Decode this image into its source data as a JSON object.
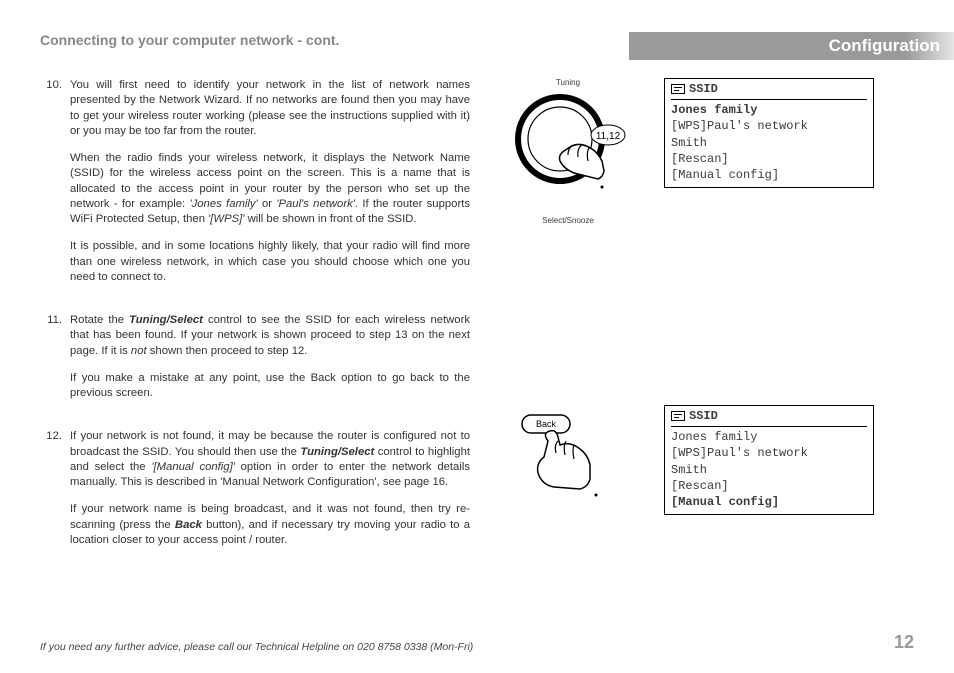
{
  "header": {
    "left": "Connecting to your computer network - cont.",
    "right": "Configuration"
  },
  "steps": {
    "s10": {
      "num": "10.",
      "p1a": "You will first need to identify your network in the list of network names presented by the Network Wizard. If no networks are found then you may have to get your wireless router working (please see the instructions supplied with it) or you may be too far from the router.",
      "p2a": "When the radio finds your wireless network, it displays the Network Name (SSID) for the wireless access point on the screen. This is a name that is allocated to the access point in your router by the person who set up the network - for example: ",
      "p2b": "'Jones family'",
      "p2c": " or ",
      "p2d": "'Paul's network'",
      "p2e": ". If the router supports WiFi Protected Setup, then ",
      "p2f": "'[WPS]'",
      "p2g": " will be shown in front of the SSID.",
      "p3": "It is possible, and in some locations highly likely, that your radio will find more than one wireless network, in which case you should choose which one you need to connect to."
    },
    "s11": {
      "num": "11.",
      "p1a": "Rotate the ",
      "p1b": "Tuning/Select",
      "p1c": " control to see the SSID for each wireless network that has been found. If your network is shown proceed to step 13 on the next page. If it is ",
      "p1d": "not",
      "p1e": " shown then proceed to step 12.",
      "p2": "If you make a mistake at any point, use the Back option to go back to the previous screen."
    },
    "s12": {
      "num": "12.",
      "p1a": "If your network is not found, it may be because the router is configured not to broadcast the SSID. You should then use the ",
      "p1b": "Tuning/Select",
      "p1c": " control to highlight and select the ",
      "p1d": "'[Manual config]'",
      "p1e": " option in order to enter the network details manually. This is described in 'Manual Network Configuration', see page 16.",
      "p2a": "If your network name is being broadcast, and it was not found, then try re-scanning (press the ",
      "p2b": "Back",
      "p2c": " button), and if necessary try moving your radio to a location closer to your access point / router."
    }
  },
  "dial": {
    "top": "Tuning",
    "bottom": "Select/Snooze",
    "bubble": "11,12"
  },
  "back": {
    "label": "Back"
  },
  "screen1": {
    "title": "SSID",
    "r1": "Jones family",
    "r2": "[WPS]Paul's network",
    "r3": "Smith",
    "r4": "[Rescan]",
    "r5": "[Manual config]"
  },
  "screen2": {
    "title": "SSID",
    "r1": "Jones family",
    "r2": "[WPS]Paul's network",
    "r3": "Smith",
    "r4": "[Rescan]",
    "r5": "[Manual config]"
  },
  "footer": {
    "help": "If you need any further advice, please call our Technical Helpline on 020 8758 0338 (Mon-Fri)",
    "page": "12"
  }
}
